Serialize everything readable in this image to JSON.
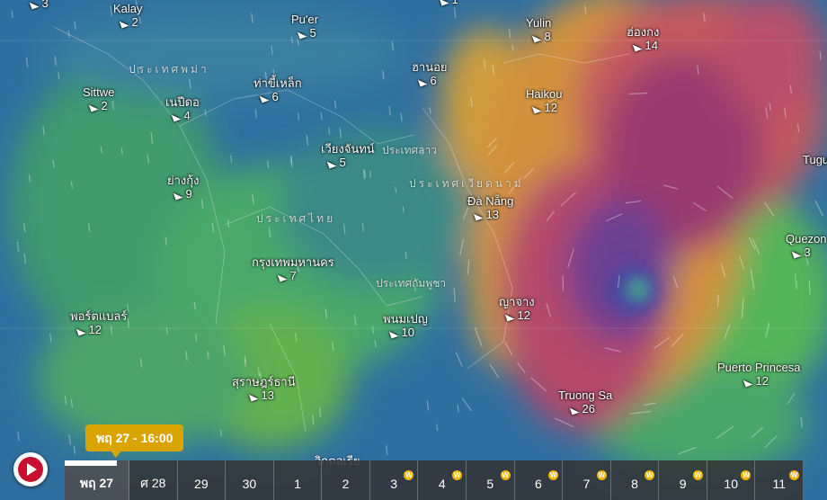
{
  "countries": [
    {
      "name": "ประเทศพม่า",
      "cls": ""
    },
    {
      "name": "ประเทศลาว",
      "cls": "small"
    },
    {
      "name": "ประเทศเวียดนาม",
      "cls": ""
    },
    {
      "name": "ประเทศไทย",
      "cls": ""
    },
    {
      "name": "ประเทศกัมพูชา",
      "cls": "small"
    }
  ],
  "cities": [
    {
      "name": "",
      "wind": "3"
    },
    {
      "name": "Kalay",
      "wind": "2"
    },
    {
      "name": "Pu'er",
      "wind": "5"
    },
    {
      "name": "",
      "wind": "1"
    },
    {
      "name": "Yulin",
      "wind": "8"
    },
    {
      "name": "ฮ่องกง",
      "wind": "14"
    },
    {
      "name": "ฮานอย",
      "wind": "6"
    },
    {
      "name": "ท่าขี้เหล็ก",
      "wind": "6"
    },
    {
      "name": "Sittwe",
      "wind": "2"
    },
    {
      "name": "เนปีดอ",
      "wind": "4"
    },
    {
      "name": "Haikou",
      "wind": "12"
    },
    {
      "name": "เวียงจันทน์",
      "wind": "5"
    },
    {
      "name": "ย่างกุ้ง",
      "wind": "9"
    },
    {
      "name": "Đà Nẵng",
      "wind": "13"
    },
    {
      "name": "Tugu",
      "wind": ""
    },
    {
      "name": "Quezon",
      "wind": "3"
    },
    {
      "name": "กรุงเทพมหานคร",
      "wind": "7"
    },
    {
      "name": "พอร์ตแบลร์",
      "wind": "12"
    },
    {
      "name": "ญาจาง",
      "wind": "12"
    },
    {
      "name": "พนมเปญ",
      "wind": "10"
    },
    {
      "name": "Puerto Princesa",
      "wind": "12"
    },
    {
      "name": "สุราษฎร์ธานี",
      "wind": "13"
    },
    {
      "name": "Truong Sa",
      "wind": "26"
    }
  ],
  "bottom_label": "วิกตอเรีย",
  "play_button_icon": "play-icon",
  "tooltip": "พฤ 27 - 16:00",
  "playback_progress": 0.07,
  "timeline": [
    {
      "label": "พฤ 27",
      "premium": false
    },
    {
      "label": "ศ 28",
      "premium": false
    },
    {
      "label": "29",
      "premium": false
    },
    {
      "label": "30",
      "premium": false
    },
    {
      "label": "1",
      "premium": false
    },
    {
      "label": "2",
      "premium": false
    },
    {
      "label": "3",
      "premium": true
    },
    {
      "label": "4",
      "premium": true
    },
    {
      "label": "5",
      "premium": true
    },
    {
      "label": "6",
      "premium": true
    },
    {
      "label": "7",
      "premium": true
    },
    {
      "label": "8",
      "premium": true
    },
    {
      "label": "9",
      "premium": true
    },
    {
      "label": "10",
      "premium": true
    },
    {
      "label": "11",
      "premium": true
    }
  ],
  "premium_badge": "W",
  "colors": {
    "calm": "#2e6ea3",
    "light": "#3a9a6a",
    "moderate": "#6fb84a",
    "strong": "#d89a3a",
    "very_strong": "#b8506a",
    "extreme": "#8a3a8a",
    "tooltip": "#d9a300",
    "play": "#c8102e"
  }
}
